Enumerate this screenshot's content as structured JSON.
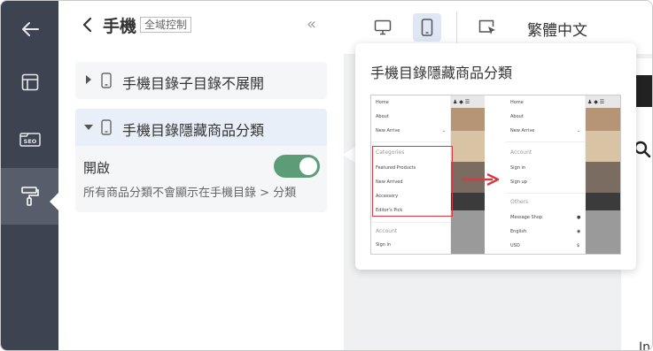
{
  "rail": {
    "items": [
      {
        "name": "back",
        "icon": "arrow-left-icon"
      },
      {
        "name": "layout",
        "icon": "layout-icon"
      },
      {
        "name": "seo",
        "icon": "seo-icon",
        "label": "SEO"
      },
      {
        "name": "design",
        "icon": "paint-roller-icon",
        "active": true
      }
    ]
  },
  "panel": {
    "title": "手機",
    "scope_tag": "全域控制",
    "collapse_icon": "«",
    "items": [
      {
        "label": "手機目錄子目錄不展開",
        "expanded": false
      },
      {
        "label": "手機目錄隱藏商品分類",
        "expanded": true,
        "toggle_label": "開啟",
        "toggle_on": true,
        "description": "所有商品分類不會顯示在手機目錄 > 分類"
      }
    ]
  },
  "toolbar": {
    "language": "繁體中文",
    "device": "mobile"
  },
  "popover": {
    "title": "手機目錄隱藏商品分類",
    "left_mock": {
      "menu": [
        "Home",
        "About",
        "New Arrive"
      ],
      "categories_head": "Categories",
      "categories": [
        "Featured Products",
        "New Arrived",
        "Accessory",
        "Editor's Pick"
      ],
      "account_head": "Account",
      "account": [
        "Sign in"
      ]
    },
    "right_mock": {
      "menu": [
        "Home",
        "About",
        "New Arrive"
      ],
      "account_head": "Account",
      "account": [
        "Sign in",
        "Sign up"
      ],
      "others_head": "Others",
      "others": [
        "Message Shop",
        "English",
        "USD"
      ],
      "others_icons": [
        "●",
        "◉",
        "$"
      ]
    }
  },
  "preview": {
    "trailing_text": "In"
  },
  "colors": {
    "rail_bg": "#3d4351",
    "rail_active": "#575d6b",
    "toggle_on": "#5c9d78",
    "highlight": "#d43b43",
    "device_active_bg": "#dfe7f5"
  }
}
